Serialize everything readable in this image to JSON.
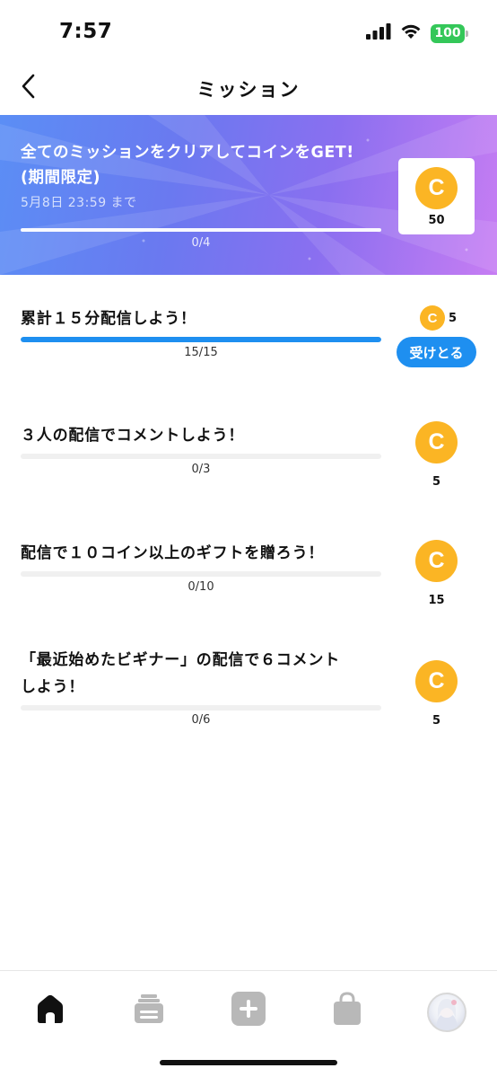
{
  "status_bar": {
    "time": "7:57",
    "battery": "100"
  },
  "nav": {
    "title": "ミッション",
    "back_icon": "chevron-left-icon"
  },
  "banner": {
    "title_line1": "全てのミッションをクリアしてコインをGET!",
    "title_line2": "(期間限定)",
    "deadline": "5月8日 23:59 まで",
    "progress_text": "0/4",
    "progress_fraction": 0,
    "reward_coin_label": "C",
    "reward_amount": "50"
  },
  "missions": [
    {
      "title": "累計１５分配信しよう！",
      "progress_text": "15/15",
      "progress_fraction": 1.0,
      "reward": "5",
      "claim_label": "受けとる"
    },
    {
      "title": "３人の配信でコメントしよう！",
      "progress_text": "0/3",
      "progress_fraction": 0,
      "reward": "5"
    },
    {
      "title": "配信で１０コイン以上のギフトを贈ろう！",
      "progress_text": "0/10",
      "progress_fraction": 0,
      "reward": "15"
    },
    {
      "title_line1": "「最近始めたビギナー」の配信で６コメント",
      "title_line2": "しよう！",
      "progress_text": "0/6",
      "progress_fraction": 0,
      "reward": "5"
    }
  ],
  "coin_label": "C",
  "tabs": [
    {
      "icon": "home-icon",
      "active": true
    },
    {
      "icon": "stack-icon",
      "active": false
    },
    {
      "icon": "plus-icon",
      "active": false
    },
    {
      "icon": "shopping-bag-icon",
      "active": false
    },
    {
      "icon": "avatar",
      "active": false
    }
  ],
  "colors": {
    "accent": "#1e8ff0",
    "coin": "#fbb524",
    "banner_start": "#5b8ef5",
    "banner_end": "#c77df3"
  }
}
